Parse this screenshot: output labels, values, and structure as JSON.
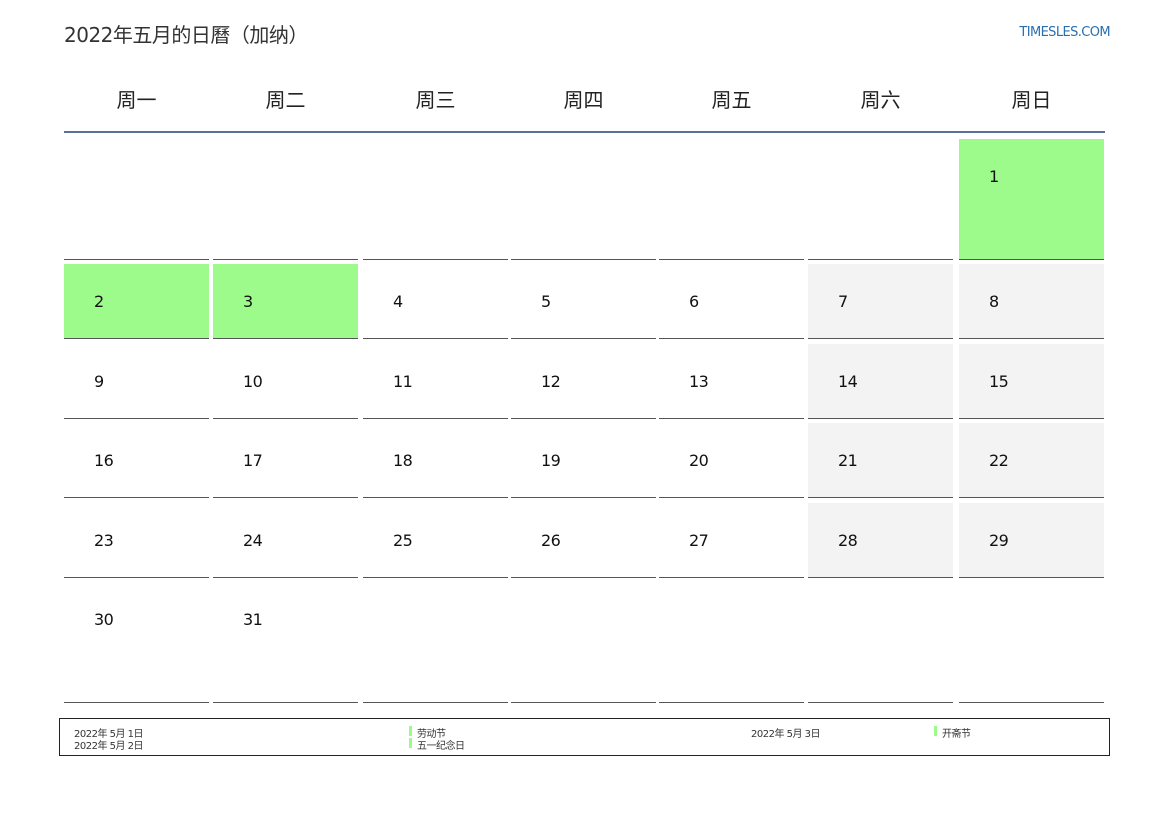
{
  "title": "2022年五月的日曆（加纳）",
  "site": "TIMESLES.COM",
  "weekdays": [
    "周一",
    "周二",
    "周三",
    "周四",
    "周五",
    "周六",
    "周日"
  ],
  "days": [
    "1",
    "2",
    "3",
    "4",
    "5",
    "6",
    "7",
    "8",
    "9",
    "10",
    "11",
    "12",
    "13",
    "14",
    "15",
    "16",
    "17",
    "18",
    "19",
    "20",
    "21",
    "22",
    "23",
    "24",
    "25",
    "26",
    "27",
    "28",
    "29",
    "30",
    "31"
  ],
  "holiday_color": "#9cfb8b",
  "weekend_color": "#f3f3f3",
  "legend": [
    {
      "date": "2022年 5月 1日",
      "name": "劳动节"
    },
    {
      "date": "2022年 5月 2日",
      "name": "五一纪念日"
    },
    {
      "date": "2022年 5月 3日",
      "name": "开斋节"
    }
  ]
}
